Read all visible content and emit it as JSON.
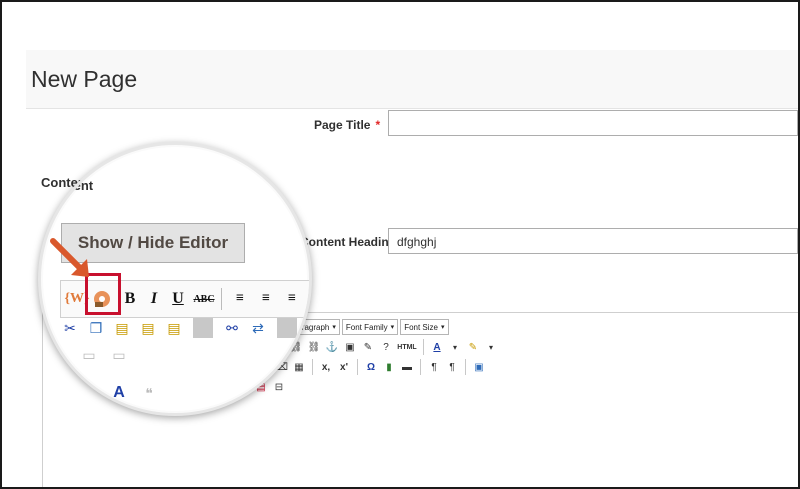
{
  "page": {
    "title": "New Page"
  },
  "form": {
    "page_title_label": "Page Title",
    "required_mark": "*",
    "page_title_value": "",
    "content_label": "Content",
    "content_heading_label": "Content Heading",
    "content_heading_value": "dfghghj"
  },
  "editor": {
    "show_hide_label": "Show / Hide Editor",
    "paragraph_select": "Paragraph",
    "font_family_select": "Font Family",
    "font_size_select": "Font Size",
    "bold_label": "B",
    "italic_label": "I",
    "underline_label": "U",
    "strike_label": "ABC",
    "html_label": "HTML"
  },
  "icons": {
    "widget": "widget-icon",
    "image": "insert-image-icon",
    "cut": "cut-icon",
    "copy": "copy-icon",
    "paste": "paste-icon",
    "find": "find-icon",
    "replace": "replace-icon",
    "list": "bullet-list-icon",
    "anchor": "anchor-icon",
    "omega": "special-char-icon"
  },
  "colors": {
    "highlight": "#c8102e",
    "arrow": "#d9582c",
    "required": "#e22626"
  }
}
